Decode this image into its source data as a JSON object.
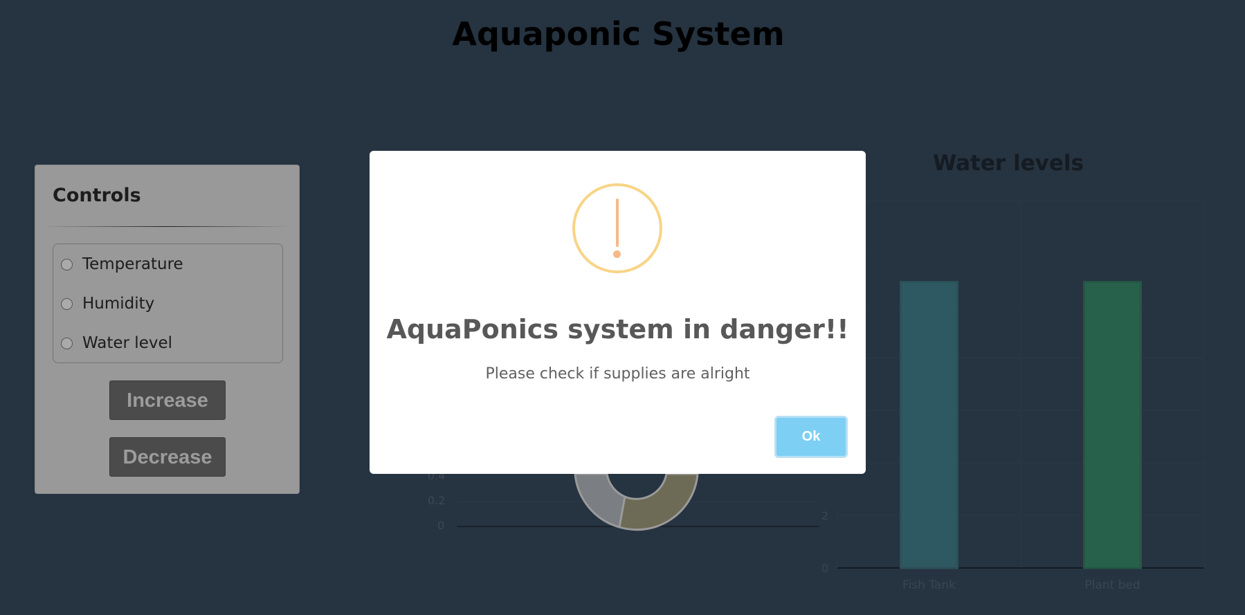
{
  "page": {
    "title": "Aquaponic System"
  },
  "controls": {
    "title": "Controls",
    "options": [
      {
        "label": "Temperature",
        "selected": false
      },
      {
        "label": "Humidity",
        "selected": false
      },
      {
        "label": "Water level",
        "selected": false
      }
    ],
    "increase_label": "Increase",
    "decrease_label": "Decrease"
  },
  "colors": {
    "background": "#263340",
    "modal_icon_ring": "#f8d486",
    "modal_icon_mark": "#f5b98a",
    "ok_button": "#7dcff4"
  },
  "left_chart": {
    "y_ticks": [
      "0.4",
      "0.2",
      "0"
    ]
  },
  "chart_data": {
    "type": "bar",
    "title": "Water levels",
    "categories": [
      "Fish Tank",
      "Plant bed"
    ],
    "values": [
      10.9,
      10.9
    ],
    "y_ticks": [
      "0",
      "2"
    ],
    "colors": [
      "#2f5962",
      "#27604b"
    ],
    "grid": true
  },
  "modal": {
    "icon": "warning-exclamation-icon",
    "title": "AquaPonics system in danger!!",
    "text": "Please check if supplies are alright",
    "ok_label": "Ok"
  }
}
